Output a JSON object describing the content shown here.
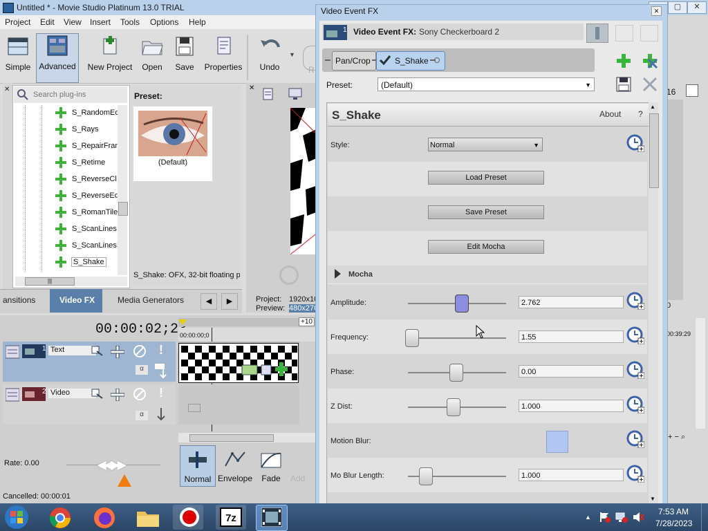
{
  "app": {
    "title": "Untitled * - Movie Studio Platinum 13.0 TRIAL",
    "window_buttons": [
      "–",
      "▢",
      "✕"
    ]
  },
  "menu": [
    "Project",
    "Edit",
    "View",
    "Insert",
    "Tools",
    "Options",
    "Help"
  ],
  "toolbar": {
    "simple": "Simple",
    "advanced": "Advanced",
    "new_project": "New Project",
    "open": "Open",
    "save": "Save",
    "properties": "Properties",
    "undo": "Undo",
    "redo_partial": "R"
  },
  "plugins": {
    "search_placeholder": "Search plug-ins",
    "items": [
      "S_RandomEd",
      "S_Rays",
      "S_RepairFran",
      "S_Retime",
      "S_ReverseCl",
      "S_ReverseEd",
      "S_RomanTile",
      "S_ScanLines",
      "S_ScanLinesI",
      "S_Shake"
    ],
    "selected_index": 9,
    "preset_label": "Preset:",
    "preset_thumb_label": "(Default)",
    "description": "S_Shake: OFX, 32-bit floating p"
  },
  "tabs": [
    "ansitions",
    "Video FX",
    "Media Generators"
  ],
  "active_tab_index": 1,
  "preview": {
    "project_label": "Project:",
    "project_value": "1920x10",
    "preview_label": "Preview:",
    "preview_value": "480x270"
  },
  "timeline": {
    "timecode": "00:00:02;23",
    "ruler_start": "00:00:00;0",
    "offset_badge": "+10",
    "tracks": [
      {
        "number": "1",
        "name": "Text"
      },
      {
        "number": "2",
        "name": "Video"
      }
    ],
    "rate_label": "Rate: 0.00",
    "status": "Cancelled: 00:00:01",
    "tools": [
      "Normal",
      "Envelope",
      "Fade",
      "Add"
    ]
  },
  "fx": {
    "window_title": "Video Event FX",
    "header_label": "Video Event FX:",
    "header_value": "Sony Checkerboard 2",
    "chain": [
      "Pan/Crop",
      "S_Shake"
    ],
    "preset_label": "Preset:",
    "preset_value": "(Default)",
    "plugin_name": "S_Shake",
    "about": "About",
    "help": "?",
    "style_label": "Style:",
    "style_value": "Normal",
    "buttons": [
      "Load Preset",
      "Save Preset",
      "Edit Mocha"
    ],
    "section": "Mocha",
    "params": [
      {
        "label": "Amplitude:",
        "value": "2.762",
        "fraction": 0.55
      },
      {
        "label": "Frequency:",
        "value": "1.55",
        "fraction": 0.03
      },
      {
        "label": "Phase:",
        "value": "0.00",
        "fraction": 0.5
      },
      {
        "label": "Z Dist:",
        "value": "1.000",
        "fraction": 0.47
      },
      {
        "label": "Mo Blur Length:",
        "value": "1.000",
        "fraction": 0.19
      }
    ],
    "motion_blur_label": "Motion Blur:"
  },
  "right_strip": {
    "value_16": "16",
    "timecode_tail": "00:39:29",
    "zero": "0"
  },
  "taskbar": {
    "time": "7:53 AM",
    "date": "7/28/2023",
    "apps": [
      "start",
      "chrome",
      "firefox",
      "explorer",
      "recorder",
      "7zip",
      "movie-studio"
    ]
  },
  "colors": {
    "title_bar": "#b9d1ea",
    "taskbar": "#2b4666",
    "slider_active": "#8c8fe0",
    "selected_tab": "#5a7fa8",
    "plus_green": "#3ab53a"
  }
}
